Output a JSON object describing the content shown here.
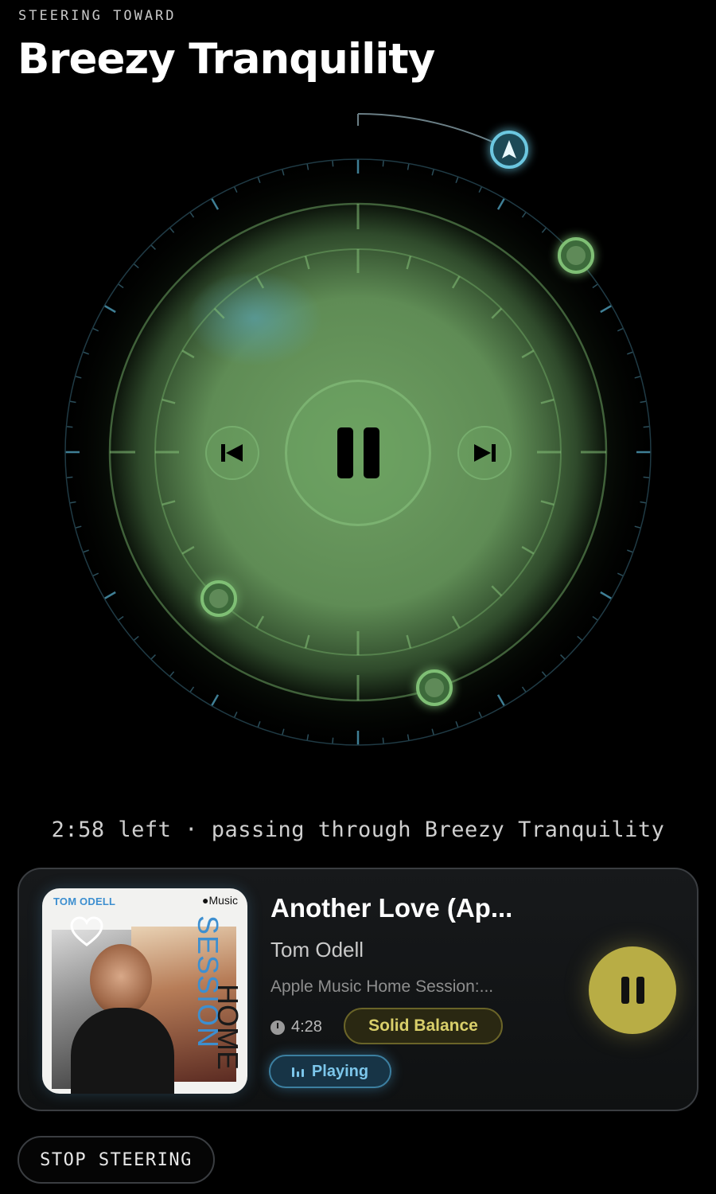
{
  "header": {
    "eyebrow": "STEERING TOWARD",
    "title": "Breezy Tranquility"
  },
  "status": {
    "line": "2:58 left · passing through Breezy Tranquility"
  },
  "now_playing": {
    "title": "Another Love (Ap...",
    "artist": "Tom Odell",
    "album": "Apple Music Home Session:...",
    "duration": "4:28",
    "mood": "Solid Balance",
    "state": "Playing",
    "artwork": {
      "artist_text": "TOM ODELL",
      "brand_text": "Music",
      "series_word_1": "SESSION",
      "series_word_2": "HOME"
    }
  },
  "actions": {
    "stop": "STOP STEERING"
  },
  "icons": {
    "prev": "skip-previous-icon",
    "next": "skip-next-icon",
    "pause": "pause-icon",
    "heart": "heart-icon",
    "clock": "clock-icon",
    "equalizer": "equalizer-icon",
    "compass": "navigation-arrow-icon"
  },
  "colors": {
    "accent_green": "#7fbf74",
    "accent_blue": "#6cc7e0",
    "accent_yellow": "#b8ad45",
    "background": "#000000"
  }
}
